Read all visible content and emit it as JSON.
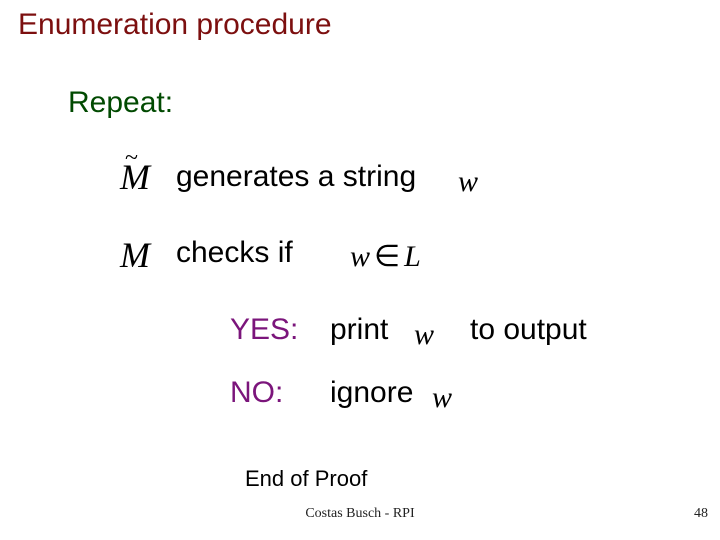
{
  "title": "Enumeration procedure",
  "repeat": "Repeat:",
  "symbols": {
    "M_tilde": "M",
    "tilde": "~",
    "M": "M",
    "w": "w",
    "in": "∈",
    "L": "L"
  },
  "lines": {
    "generates": "generates a string",
    "checks": "checks  if"
  },
  "branches": {
    "yes_label": "YES:",
    "yes_action": "print",
    "yes_tail": "to output",
    "no_label": "NO:",
    "no_action": "ignore"
  },
  "end_proof": "End of Proof",
  "footer": "Costas Busch - RPI",
  "page_number": "48"
}
